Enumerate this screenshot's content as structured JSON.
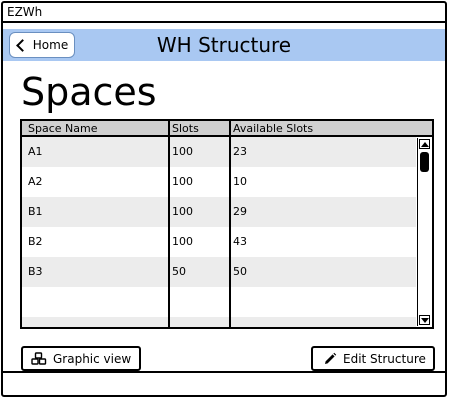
{
  "app": {
    "title": "EZWh"
  },
  "header": {
    "home_label": "Home",
    "title": "WH Structure"
  },
  "page": {
    "title": "Spaces"
  },
  "table": {
    "columns": [
      "Space Name",
      "Slots",
      "Available Slots"
    ],
    "rows": [
      [
        "A1",
        "100",
        "23"
      ],
      [
        "A2",
        "100",
        "10"
      ],
      [
        "B1",
        "100",
        "29"
      ],
      [
        "B2",
        "100",
        "43"
      ],
      [
        "B3",
        "50",
        "50"
      ]
    ]
  },
  "actions": {
    "graphic_view": "Graphic view",
    "edit_structure": "Edit Structure"
  },
  "colors": {
    "header_bg": "#a9c8f2",
    "table_header_bg": "#d0d0d0",
    "row_alt_bg": "#ececec"
  },
  "icons": {
    "home": "chevron-left-icon",
    "graphic": "cubes-icon",
    "edit": "pencil-icon"
  }
}
